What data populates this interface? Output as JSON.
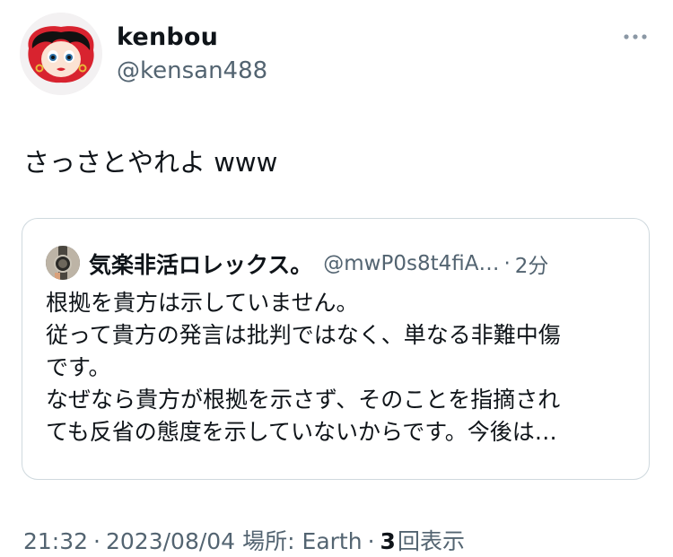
{
  "author": {
    "display_name": "kenbou",
    "handle": "@kensan488"
  },
  "tweet": {
    "text": "さっさとやれよ www"
  },
  "quoted_tweet": {
    "display_name": "気楽非活ロレックス。",
    "handle": "@mwP0s8t4fiA…",
    "separator": "·",
    "time": "2分",
    "lines": [
      "根拠を貴方は示していません。",
      "従って貴方の発言は批判ではなく、単なる非難中傷",
      "です。",
      "なぜなら貴方が根拠を示さず、そのことを指摘され",
      "ても反省の態度を示していないからです。今後は…"
    ]
  },
  "meta": {
    "time": "21:32",
    "sep1": "·",
    "date": "2023/08/04",
    "location_label": "場所:",
    "location": "Earth",
    "sep2": "·",
    "views_count": "3",
    "views_label": "回表示"
  },
  "icons": {
    "more": "more-horizontal-icon",
    "avatar": "betty-boop-avatar",
    "quoted_avatar": "wristwatch-avatar"
  },
  "colors": {
    "text_primary": "#0f1419",
    "text_secondary": "#536471",
    "border": "#cfd9de",
    "background": "#ffffff"
  }
}
